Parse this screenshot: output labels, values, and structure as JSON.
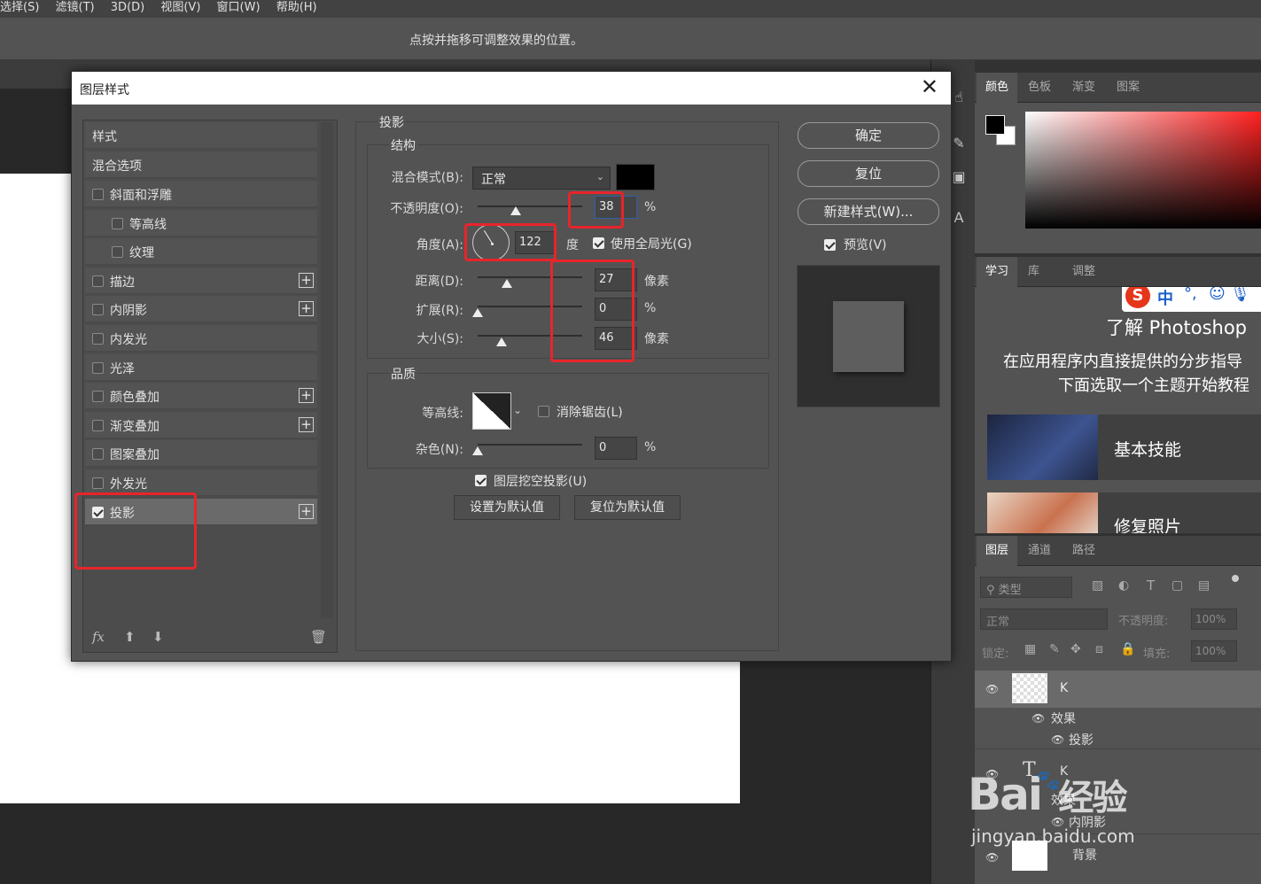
{
  "menu": [
    "选择(S)",
    "滤镜(T)",
    "3D(D)",
    "视图(V)",
    "窗口(W)",
    "帮助(H)"
  ],
  "options_hint": "点按并拖移可调整效果的位置。",
  "dialog": {
    "title": "图层样式",
    "styles_header": "样式",
    "blend_options": "混合选项",
    "styles": [
      {
        "label": "斜面和浮雕",
        "checked": false,
        "indent": false,
        "plus": false
      },
      {
        "label": "等高线",
        "checked": false,
        "indent": true,
        "plus": false
      },
      {
        "label": "纹理",
        "checked": false,
        "indent": true,
        "plus": false
      },
      {
        "label": "描边",
        "checked": false,
        "indent": false,
        "plus": true
      },
      {
        "label": "内阴影",
        "checked": false,
        "indent": false,
        "plus": true
      },
      {
        "label": "内发光",
        "checked": false,
        "indent": false,
        "plus": false
      },
      {
        "label": "光泽",
        "checked": false,
        "indent": false,
        "plus": false
      },
      {
        "label": "颜色叠加",
        "checked": false,
        "indent": false,
        "plus": true
      },
      {
        "label": "渐变叠加",
        "checked": false,
        "indent": false,
        "plus": true
      },
      {
        "label": "图案叠加",
        "checked": false,
        "indent": false,
        "plus": false
      },
      {
        "label": "外发光",
        "checked": false,
        "indent": false,
        "plus": false
      },
      {
        "label": "投影",
        "checked": true,
        "indent": false,
        "plus": true
      }
    ],
    "fx_label": "fx",
    "section_title": "投影",
    "structure": {
      "title": "结构",
      "blend_mode_label": "混合模式(B):",
      "blend_mode_value": "正常",
      "shadow_color": "#000000",
      "opacity_label": "不透明度(O):",
      "opacity_value": "38",
      "opacity_unit": "%",
      "angle_label": "角度(A):",
      "angle_value": "122",
      "angle_unit": "度",
      "global_light_label": "使用全局光(G)",
      "global_light_checked": true,
      "distance_label": "距离(D):",
      "distance_value": "27",
      "distance_unit": "像素",
      "spread_label": "扩展(R):",
      "spread_value": "0",
      "spread_unit": "%",
      "size_label": "大小(S):",
      "size_value": "46",
      "size_unit": "像素"
    },
    "quality": {
      "title": "品质",
      "contour_label": "等高线:",
      "antialias_label": "消除锯齿(L)",
      "noise_label": "杂色(N):",
      "noise_value": "0",
      "noise_unit": "%"
    },
    "knockout_label": "图层挖空投影(U)",
    "set_default": "设置为默认值",
    "reset_default": "复位为默认值",
    "ok": "确定",
    "reset": "复位",
    "new_style": "新建样式(W)...",
    "preview_label": "预览(V)"
  },
  "panels": {
    "color_tabs": [
      "颜色",
      "色板",
      "渐变",
      "图案"
    ],
    "learn_tabs": [
      "学习",
      "库",
      "调整"
    ],
    "learn_title": "了解 Photoshop",
    "learn_desc1": "在应用程序内直接提供的分步指导",
    "learn_desc2": "下面选取一个主题开始教程",
    "learn_cards": [
      "基本技能",
      "修复照片"
    ],
    "ime_badge": "中",
    "layer_tabs": [
      "图层",
      "通道",
      "路径"
    ],
    "filter_placeholder": "类型",
    "blend_mode": "正常",
    "opacity_label": "不透明度:",
    "opacity_value": "100%",
    "lock_label": "锁定:",
    "fill_label": "填充:",
    "fill_value": "100%",
    "layers": [
      {
        "name": "K",
        "sub_effects": "效果",
        "effect": "投影"
      },
      {
        "name": "K",
        "sub_effects": "效果",
        "effect": "内阴影"
      },
      {
        "name": "背景"
      }
    ]
  },
  "watermark": {
    "brand": "Bai",
    "brand2": "经验",
    "url": "jingyan.baidu.com"
  }
}
